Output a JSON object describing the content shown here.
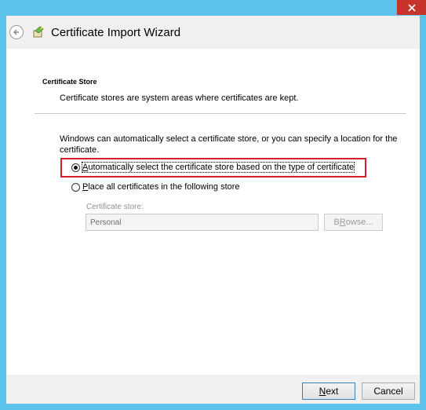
{
  "window": {
    "title": "Certificate Import Wizard",
    "close_icon": "close-icon",
    "back_icon": "back-arrow-icon",
    "wizard_icon": "certificate-wizard-icon"
  },
  "section": {
    "title": "Certificate Store",
    "description": "Certificate stores are system areas where certificates are kept."
  },
  "intro": "Windows can automatically select a certificate store, or you can specify a location for the certificate.",
  "options": {
    "auto": {
      "mnemonic": "A",
      "rest": "utomatically select the certificate store based on the type of certificate",
      "selected": true
    },
    "manual": {
      "mnemonic": "P",
      "rest": "lace all certificates in the following store",
      "selected": false
    }
  },
  "store": {
    "label": "Certificate store:",
    "value": "Personal",
    "browse_mnemonic": "R",
    "browse_pre": "B",
    "browse_post": "owse..."
  },
  "footer": {
    "next_mnemonic": "N",
    "next_rest": "ext",
    "cancel": "Cancel"
  },
  "colors": {
    "frame": "#5bc3e9",
    "close": "#c7342a",
    "highlight": "#d4202a"
  }
}
